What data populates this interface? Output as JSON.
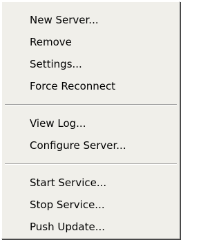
{
  "menu": {
    "groups": [
      {
        "items": [
          {
            "label": "New Server..."
          },
          {
            "label": "Remove"
          },
          {
            "label": "Settings..."
          },
          {
            "label": "Force Reconnect"
          }
        ]
      },
      {
        "items": [
          {
            "label": "View Log..."
          },
          {
            "label": "Configure Server..."
          }
        ]
      },
      {
        "items": [
          {
            "label": "Start Service..."
          },
          {
            "label": "Stop Service..."
          },
          {
            "label": "Push Update..."
          }
        ]
      }
    ]
  }
}
